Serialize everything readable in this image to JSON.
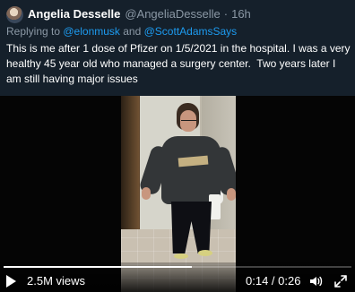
{
  "tweet": {
    "author_name": "Angelia Desselle",
    "handle": "@AngeliaDesselle",
    "separator": "·",
    "time": "16h",
    "reply_prefix": "Replying to ",
    "reply_mention_1": "@elonmusk",
    "reply_conjunction": " and ",
    "reply_mention_2": "@ScottAdamsSays",
    "text": "This is me after 1 dose of Pfizer on 1/5/2021 in the hospital. I was a very healthy 45 year old who managed a surgery center.  Two years later I am still having major issues"
  },
  "video": {
    "views_label": "2.5M views",
    "time_readout": "0:14 / 0:26",
    "progress_fraction": 0.54,
    "icons": {
      "play": "play-icon",
      "volume": "volume-icon",
      "fullscreen": "fullscreen-icon"
    }
  },
  "colors": {
    "background": "#15202b",
    "primary_text": "#ffffff",
    "secondary_text": "#8b98a5",
    "mention": "#1d9bf0"
  }
}
